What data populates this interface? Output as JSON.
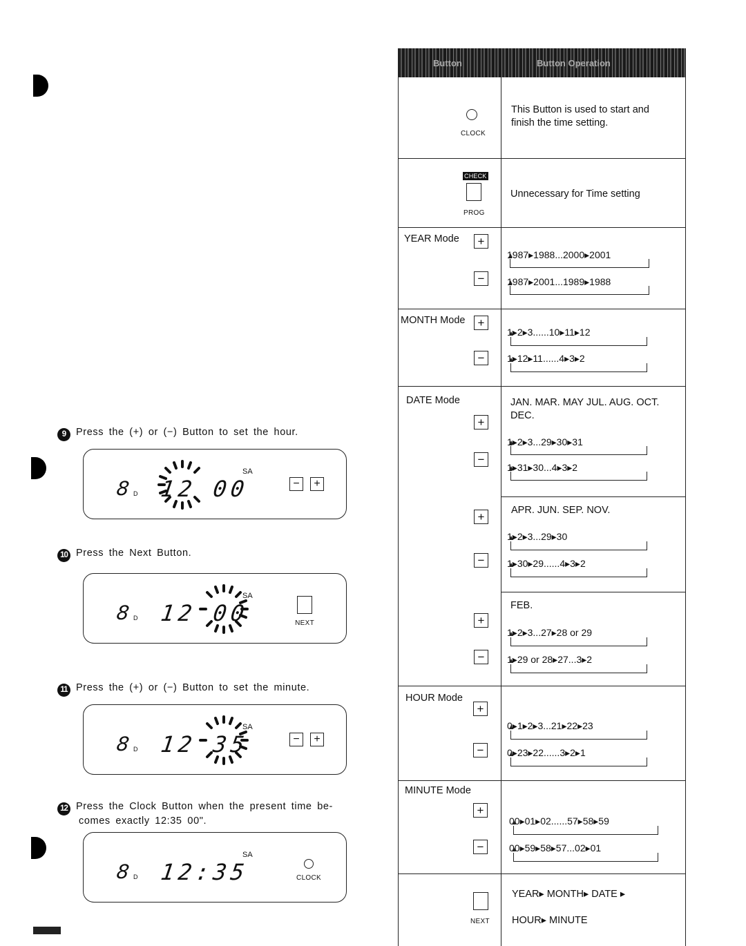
{
  "steps": [
    {
      "number": "9",
      "text": "Press the (+) or (−) Button to set the hour.",
      "display": {
        "day": "8",
        "day_suffix": "D",
        "time": "12 00",
        "indicator": "SA",
        "blinking": "hour",
        "buttons": [
          "−",
          "+"
        ]
      }
    },
    {
      "number": "10",
      "text": "Press the Next Button.",
      "display": {
        "day": "8",
        "day_suffix": "D",
        "time": "12 00",
        "indicator": "SA",
        "blinking": "minute",
        "button_label": "NEXT"
      }
    },
    {
      "number": "11",
      "text": "Press the (+) or (−) Button to set the minute.",
      "display": {
        "day": "8",
        "day_suffix": "D",
        "time": "12 35",
        "indicator": "SA",
        "blinking": "minute",
        "buttons": [
          "−",
          "+"
        ]
      }
    },
    {
      "number": "12",
      "text": "Press the Clock Button when the present time be-",
      "text_cont": "comes exactly 12:35 00\".",
      "display": {
        "day": "8",
        "day_suffix": "D",
        "time": "12:35",
        "indicator": "SA",
        "button_label": "CLOCK"
      }
    }
  ],
  "table": {
    "headers": [
      "Button",
      "Button Operation"
    ],
    "rows": [
      {
        "button": "CLOCK",
        "icon": "circle",
        "content": "This Button is used to start and finish the time setting."
      },
      {
        "button": "PROG",
        "tag": "CHECK",
        "icon": "square",
        "content": "Unnecessary for Time setting"
      },
      {
        "mode": "YEAR Mode",
        "plus": "+",
        "minus": "−",
        "plus_seq": "1987▸1988...2000▸2001",
        "minus_seq": "1987▸2001...1989▸1988"
      },
      {
        "mode": "MONTH Mode",
        "plus": "+",
        "minus": "−",
        "plus_seq": "1▸2▸3......10▸11▸12",
        "minus_seq": "1▸12▸11......4▸3▸2"
      },
      {
        "mode": "DATE Mode",
        "groups": [
          {
            "months": "JAN. MAR. MAY JUL. AUG. OCT. DEC.",
            "plus_seq": "1▸2▸3...29▸30▸31",
            "minus_seq": "1▸31▸30...4▸3▸2"
          },
          {
            "months": "APR. JUN. SEP. NOV.",
            "plus_seq": "1▸2▸3...29▸30",
            "minus_seq": "1▸30▸29......4▸3▸2"
          },
          {
            "months": "FEB.",
            "plus_seq": "1▸2▸3...27▸28 or 29",
            "minus_seq": "1▸29 or 28▸27...3▸2"
          }
        ]
      },
      {
        "mode": "HOUR Mode",
        "plus": "+",
        "minus": "−",
        "plus_seq": "0▸1▸2▸3...21▸22▸23",
        "minus_seq": "0▸23▸22......3▸2▸1"
      },
      {
        "mode": "MINUTE Mode",
        "plus": "+",
        "minus": "−",
        "plus_seq": "00▸01▸02......57▸58▸59",
        "minus_seq": "00▸59▸58▸57...02▸01"
      },
      {
        "button": "NEXT",
        "icon": "square",
        "content_line1": "YEAR▸ MONTH▸ DATE ▸",
        "content_line2": "HOUR▸ MINUTE"
      }
    ]
  }
}
